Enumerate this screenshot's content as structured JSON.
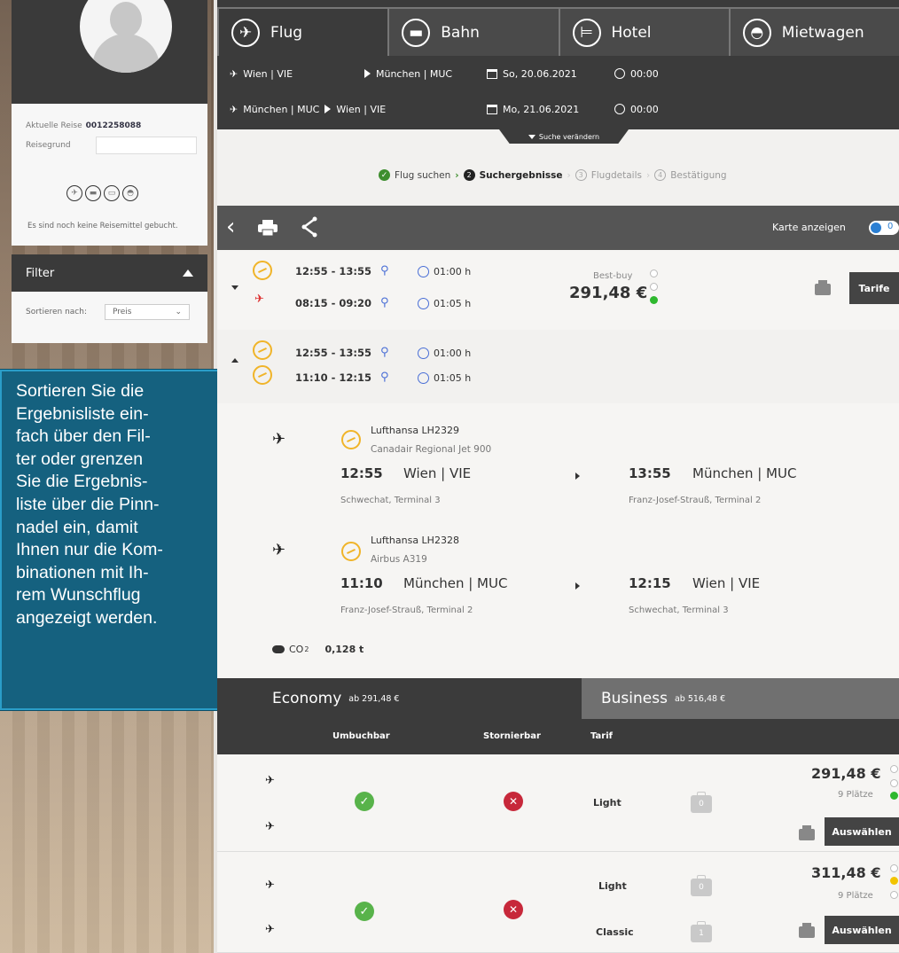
{
  "sidebar": {
    "trip_label": "Aktuelle Reise",
    "trip_number": "0012258088",
    "reason_label": "Reisegrund",
    "no_booking": "Es sind noch keine Reisemittel gebucht.",
    "filter_title": "Filter",
    "sort_label": "Sortieren nach:",
    "sort_value": "Preis"
  },
  "callout": {
    "lines": [
      "Sortieren Sie die",
      "Ergebnisliste ein-",
      "fach  über den Fil-",
      "ter oder grenzen",
      "Sie die Ergebnis-",
      "liste über die Pinn-",
      "nadel ein, damit",
      "Ihnen nur die Kom-",
      "binationen mit Ih-",
      "rem Wunschflug",
      "angezeigt werden."
    ]
  },
  "tabs": [
    {
      "label": "Flug"
    },
    {
      "label": "Bahn"
    },
    {
      "label": "Hotel"
    },
    {
      "label": "Mietwagen"
    }
  ],
  "routes": [
    {
      "from": "Wien | VIE",
      "to": "München | MUC",
      "date": "So, 20.06.2021",
      "time": "00:00"
    },
    {
      "from": "München | MUC",
      "to": "Wien | VIE",
      "date": "Mo, 21.06.2021",
      "time": "00:00"
    }
  ],
  "search_change": "Suche verändern",
  "steps": {
    "s1": "Flug suchen",
    "s2": "Suchergebnisse",
    "s3": "Flugdetails",
    "s4": "Bestätigung",
    "n2": "2",
    "n3": "3",
    "n4": "4"
  },
  "toolbar": {
    "map_label": "Karte anzeigen",
    "toggle_count": "0"
  },
  "result1": {
    "out_time": "12:55 - 13:55",
    "out_dur": "01:00 h",
    "ret_time": "08:15 - 09:20",
    "ret_dur": "01:05 h",
    "best_buy": "Best-buy",
    "price": "291,48 €",
    "tarife": "Tarife"
  },
  "result2": {
    "out_time": "12:55 - 13:55",
    "out_dur": "01:00 h",
    "ret_time": "11:10 - 12:15",
    "ret_dur": "01:05 h"
  },
  "detail": {
    "f1": {
      "name": "Lufthansa LH2329",
      "aircraft": "Canadair Regional Jet 900",
      "dep_time": "12:55",
      "dep_city": "Wien | VIE",
      "arr_time": "13:55",
      "arr_city": "München | MUC",
      "dep_term": "Schwechat, Terminal 3",
      "arr_term": "Franz-Josef-Strauß, Terminal 2"
    },
    "f2": {
      "name": "Lufthansa LH2328",
      "aircraft": "Airbus A319",
      "dep_time": "11:10",
      "dep_city": "München | MUC",
      "arr_time": "12:15",
      "arr_city": "Wien | VIE",
      "dep_term": "Franz-Josef-Strauß, Terminal 2",
      "arr_term": "Schwechat, Terminal 3"
    },
    "co2_label": "CO",
    "co2_sub": "2",
    "co2_value": "0,128 t"
  },
  "classes": {
    "economy": "Economy",
    "economy_from": "ab 291,48 €",
    "business": "Business",
    "business_from": "ab 516,48 €"
  },
  "tarif_head": {
    "umbuchbar": "Umbuchbar",
    "stornierbar": "Stornierbar",
    "tarif": "Tarif"
  },
  "fares": [
    {
      "name1": "Light",
      "bag1": "0",
      "price": "291,48 €",
      "seats": "9 Plätze",
      "button": "Auswählen"
    },
    {
      "name1": "Light",
      "bag1": "0",
      "name2": "Classic",
      "bag2": "1",
      "price": "311,48 €",
      "seats": "9 Plätze",
      "button": "Auswählen"
    }
  ],
  "colors": {
    "accent_blue": "#15617f",
    "ok_green": "#58b34a",
    "cancel_red": "#c7283a",
    "lufthansa_yellow": "#f0b429"
  }
}
